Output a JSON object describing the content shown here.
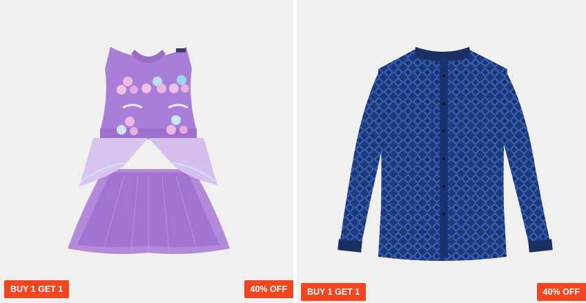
{
  "colors": {
    "badge_bg": "#f1461f",
    "card_bg": "#f1f0ee"
  },
  "products": [
    {
      "image_alt": "Purple sleeveless tulle dress with floral appliqués",
      "offer_badge": "BUY 1 GET 1",
      "discount_badge": "40% OFF"
    },
    {
      "image_alt": "Navy blue long-sleeve printed shirt",
      "offer_badge": "BUY 1 GET 1",
      "discount_badge": "40% OFF"
    }
  ]
}
